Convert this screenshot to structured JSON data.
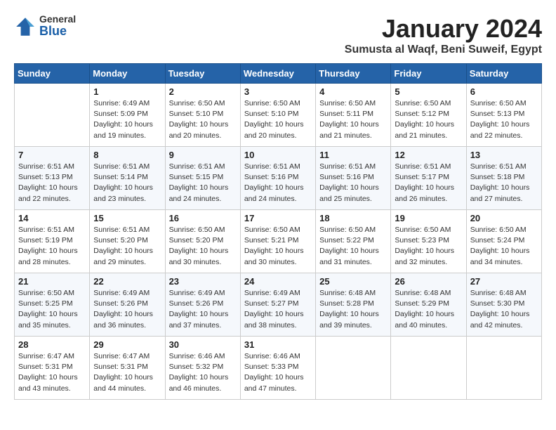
{
  "logo": {
    "general": "General",
    "blue": "Blue"
  },
  "title": "January 2024",
  "location": "Sumusta al Waqf, Beni Suweif, Egypt",
  "days_of_week": [
    "Sunday",
    "Monday",
    "Tuesday",
    "Wednesday",
    "Thursday",
    "Friday",
    "Saturday"
  ],
  "weeks": [
    [
      {
        "num": "",
        "sunrise": "",
        "sunset": "",
        "daylight": ""
      },
      {
        "num": "1",
        "sunrise": "Sunrise: 6:49 AM",
        "sunset": "Sunset: 5:09 PM",
        "daylight": "Daylight: 10 hours and 19 minutes."
      },
      {
        "num": "2",
        "sunrise": "Sunrise: 6:50 AM",
        "sunset": "Sunset: 5:10 PM",
        "daylight": "Daylight: 10 hours and 20 minutes."
      },
      {
        "num": "3",
        "sunrise": "Sunrise: 6:50 AM",
        "sunset": "Sunset: 5:10 PM",
        "daylight": "Daylight: 10 hours and 20 minutes."
      },
      {
        "num": "4",
        "sunrise": "Sunrise: 6:50 AM",
        "sunset": "Sunset: 5:11 PM",
        "daylight": "Daylight: 10 hours and 21 minutes."
      },
      {
        "num": "5",
        "sunrise": "Sunrise: 6:50 AM",
        "sunset": "Sunset: 5:12 PM",
        "daylight": "Daylight: 10 hours and 21 minutes."
      },
      {
        "num": "6",
        "sunrise": "Sunrise: 6:50 AM",
        "sunset": "Sunset: 5:13 PM",
        "daylight": "Daylight: 10 hours and 22 minutes."
      }
    ],
    [
      {
        "num": "7",
        "sunrise": "Sunrise: 6:51 AM",
        "sunset": "Sunset: 5:13 PM",
        "daylight": "Daylight: 10 hours and 22 minutes."
      },
      {
        "num": "8",
        "sunrise": "Sunrise: 6:51 AM",
        "sunset": "Sunset: 5:14 PM",
        "daylight": "Daylight: 10 hours and 23 minutes."
      },
      {
        "num": "9",
        "sunrise": "Sunrise: 6:51 AM",
        "sunset": "Sunset: 5:15 PM",
        "daylight": "Daylight: 10 hours and 24 minutes."
      },
      {
        "num": "10",
        "sunrise": "Sunrise: 6:51 AM",
        "sunset": "Sunset: 5:16 PM",
        "daylight": "Daylight: 10 hours and 24 minutes."
      },
      {
        "num": "11",
        "sunrise": "Sunrise: 6:51 AM",
        "sunset": "Sunset: 5:16 PM",
        "daylight": "Daylight: 10 hours and 25 minutes."
      },
      {
        "num": "12",
        "sunrise": "Sunrise: 6:51 AM",
        "sunset": "Sunset: 5:17 PM",
        "daylight": "Daylight: 10 hours and 26 minutes."
      },
      {
        "num": "13",
        "sunrise": "Sunrise: 6:51 AM",
        "sunset": "Sunset: 5:18 PM",
        "daylight": "Daylight: 10 hours and 27 minutes."
      }
    ],
    [
      {
        "num": "14",
        "sunrise": "Sunrise: 6:51 AM",
        "sunset": "Sunset: 5:19 PM",
        "daylight": "Daylight: 10 hours and 28 minutes."
      },
      {
        "num": "15",
        "sunrise": "Sunrise: 6:51 AM",
        "sunset": "Sunset: 5:20 PM",
        "daylight": "Daylight: 10 hours and 29 minutes."
      },
      {
        "num": "16",
        "sunrise": "Sunrise: 6:50 AM",
        "sunset": "Sunset: 5:20 PM",
        "daylight": "Daylight: 10 hours and 30 minutes."
      },
      {
        "num": "17",
        "sunrise": "Sunrise: 6:50 AM",
        "sunset": "Sunset: 5:21 PM",
        "daylight": "Daylight: 10 hours and 30 minutes."
      },
      {
        "num": "18",
        "sunrise": "Sunrise: 6:50 AM",
        "sunset": "Sunset: 5:22 PM",
        "daylight": "Daylight: 10 hours and 31 minutes."
      },
      {
        "num": "19",
        "sunrise": "Sunrise: 6:50 AM",
        "sunset": "Sunset: 5:23 PM",
        "daylight": "Daylight: 10 hours and 32 minutes."
      },
      {
        "num": "20",
        "sunrise": "Sunrise: 6:50 AM",
        "sunset": "Sunset: 5:24 PM",
        "daylight": "Daylight: 10 hours and 34 minutes."
      }
    ],
    [
      {
        "num": "21",
        "sunrise": "Sunrise: 6:50 AM",
        "sunset": "Sunset: 5:25 PM",
        "daylight": "Daylight: 10 hours and 35 minutes."
      },
      {
        "num": "22",
        "sunrise": "Sunrise: 6:49 AM",
        "sunset": "Sunset: 5:26 PM",
        "daylight": "Daylight: 10 hours and 36 minutes."
      },
      {
        "num": "23",
        "sunrise": "Sunrise: 6:49 AM",
        "sunset": "Sunset: 5:26 PM",
        "daylight": "Daylight: 10 hours and 37 minutes."
      },
      {
        "num": "24",
        "sunrise": "Sunrise: 6:49 AM",
        "sunset": "Sunset: 5:27 PM",
        "daylight": "Daylight: 10 hours and 38 minutes."
      },
      {
        "num": "25",
        "sunrise": "Sunrise: 6:48 AM",
        "sunset": "Sunset: 5:28 PM",
        "daylight": "Daylight: 10 hours and 39 minutes."
      },
      {
        "num": "26",
        "sunrise": "Sunrise: 6:48 AM",
        "sunset": "Sunset: 5:29 PM",
        "daylight": "Daylight: 10 hours and 40 minutes."
      },
      {
        "num": "27",
        "sunrise": "Sunrise: 6:48 AM",
        "sunset": "Sunset: 5:30 PM",
        "daylight": "Daylight: 10 hours and 42 minutes."
      }
    ],
    [
      {
        "num": "28",
        "sunrise": "Sunrise: 6:47 AM",
        "sunset": "Sunset: 5:31 PM",
        "daylight": "Daylight: 10 hours and 43 minutes."
      },
      {
        "num": "29",
        "sunrise": "Sunrise: 6:47 AM",
        "sunset": "Sunset: 5:31 PM",
        "daylight": "Daylight: 10 hours and 44 minutes."
      },
      {
        "num": "30",
        "sunrise": "Sunrise: 6:46 AM",
        "sunset": "Sunset: 5:32 PM",
        "daylight": "Daylight: 10 hours and 46 minutes."
      },
      {
        "num": "31",
        "sunrise": "Sunrise: 6:46 AM",
        "sunset": "Sunset: 5:33 PM",
        "daylight": "Daylight: 10 hours and 47 minutes."
      },
      {
        "num": "",
        "sunrise": "",
        "sunset": "",
        "daylight": ""
      },
      {
        "num": "",
        "sunrise": "",
        "sunset": "",
        "daylight": ""
      },
      {
        "num": "",
        "sunrise": "",
        "sunset": "",
        "daylight": ""
      }
    ]
  ]
}
